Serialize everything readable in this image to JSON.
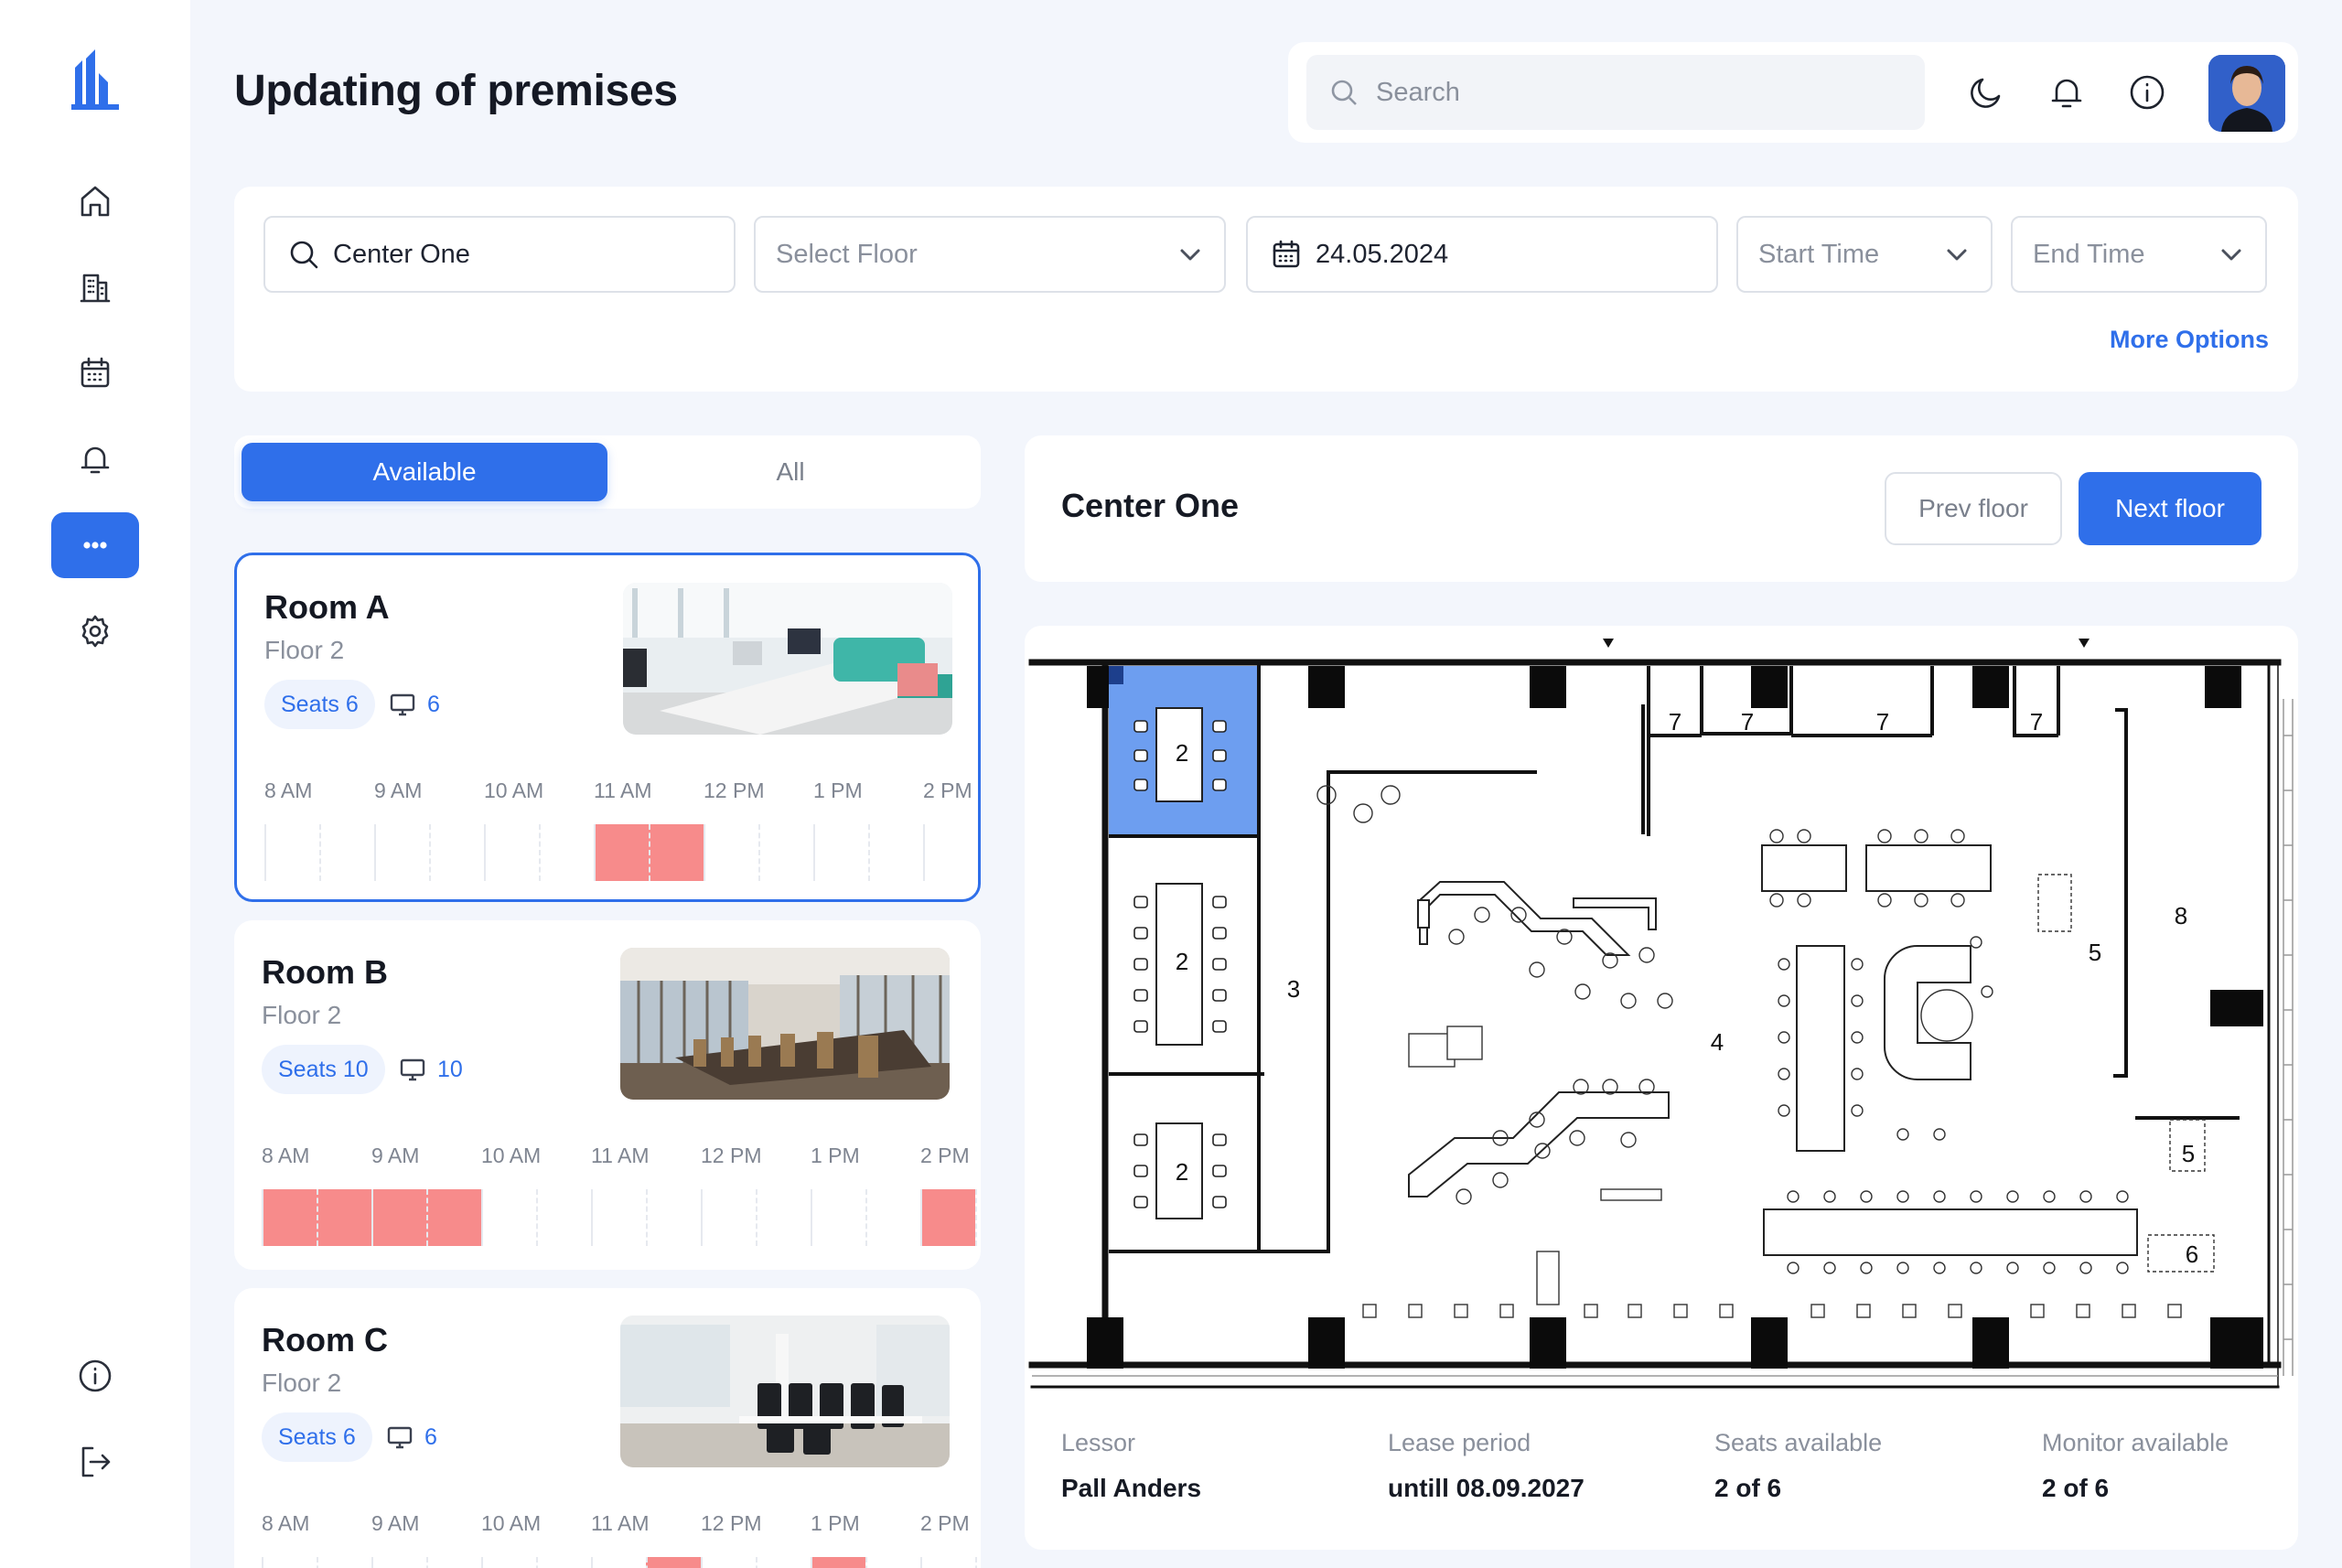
{
  "page": {
    "title": "Updating of premises"
  },
  "sidebar": {
    "items": [
      {
        "icon": "home-icon"
      },
      {
        "icon": "building-icon"
      },
      {
        "icon": "calendar-icon"
      },
      {
        "icon": "bell-icon"
      },
      {
        "icon": "more-icon",
        "active": true
      },
      {
        "icon": "gear-icon"
      }
    ],
    "bottom": [
      {
        "icon": "info-icon"
      },
      {
        "icon": "logout-icon"
      }
    ]
  },
  "topbar": {
    "search_placeholder": "Search"
  },
  "filters": {
    "location": "Center One",
    "floor_placeholder": "Select Floor",
    "date": "24.05.2024",
    "start_placeholder": "Start Time",
    "end_placeholder": "End Time",
    "more_options": "More Options"
  },
  "toggle": {
    "available": "Available",
    "all": "All"
  },
  "timeline_hours": [
    "8 AM",
    "9 AM",
    "10 AM",
    "11 AM",
    "12 PM",
    "1 PM",
    "2 PM"
  ],
  "rooms": [
    {
      "name": "Room A",
      "floor": "Floor 2",
      "seats": "Seats 6",
      "monitors": "6",
      "busy_half_hours": [
        6,
        7
      ]
    },
    {
      "name": "Room B",
      "floor": "Floor 2",
      "seats": "Seats 10",
      "monitors": "10",
      "busy_half_hours": [
        0,
        1,
        2,
        3,
        12
      ]
    },
    {
      "name": "Room C",
      "floor": "Floor 2",
      "seats": "Seats 6",
      "monitors": "6",
      "busy_half_hours": [
        7,
        10
      ]
    }
  ],
  "floor": {
    "title": "Center One",
    "prev": "Prev floor",
    "next": "Next floor",
    "room_labels": [
      "2",
      "2",
      "2",
      "3",
      "4",
      "5",
      "5",
      "6",
      "7",
      "7",
      "7",
      "7",
      "8"
    ]
  },
  "details": {
    "lessor_label": "Lessor",
    "lessor_value": "Pall Anders",
    "lease_label": "Lease period",
    "lease_value": "untill 08.09.2027",
    "seats_label": "Seats available",
    "seats_value": "2 of 6",
    "monitor_label": "Monitor available",
    "monitor_value": "2 of 6"
  },
  "colors": {
    "accent": "#2f6fea",
    "busy": "#f78b8b",
    "selected_room": "#6d9ef0"
  }
}
